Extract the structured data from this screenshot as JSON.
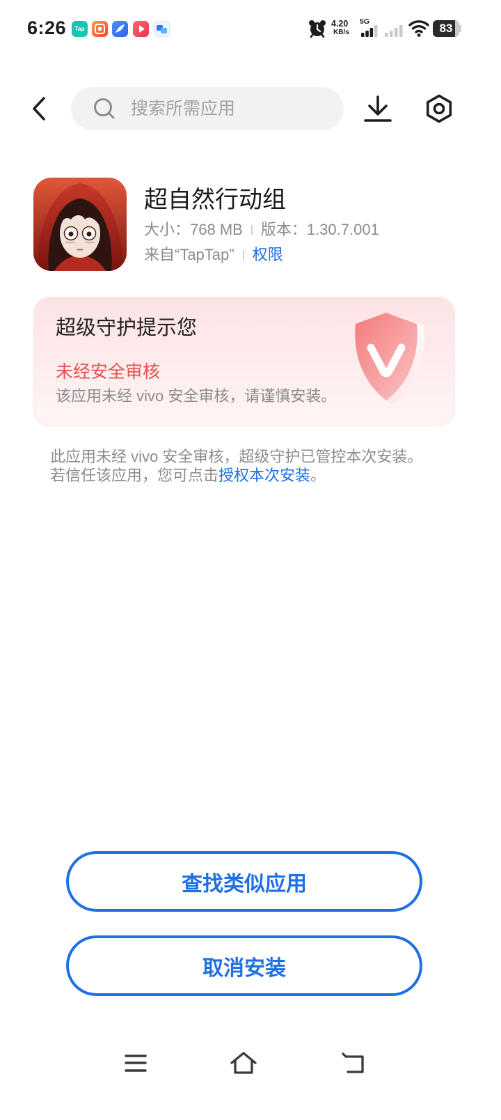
{
  "theme": {
    "accent": "#1f6fe5",
    "danger": "#e5504f"
  },
  "status_bar": {
    "time": "6:26",
    "notification_icons": [
      {
        "icon": "taptap-app-icon",
        "label": "Tap"
      },
      {
        "icon": "orange-app-icon"
      },
      {
        "icon": "blue-browser-app-icon"
      },
      {
        "icon": "red-video-app-icon"
      },
      {
        "icon": "blue-chat-app-icon"
      }
    ],
    "alarm_icon": "alarm-clock-icon",
    "net_speed": "4.20",
    "net_speed_unit": "KB/s",
    "network_type": "5G",
    "sim1_signal_bars": 3,
    "sim2_signal_bars": 0,
    "wifi_icon": "wifi-icon",
    "battery": "83"
  },
  "header": {
    "back_icon": "chevron-left-icon",
    "search_icon": "search-icon",
    "search_placeholder": "搜索所需应用",
    "search_value": "",
    "download_icon": "download-icon",
    "settings_icon": "settings-hexagon-icon"
  },
  "app": {
    "icon": "app-icon",
    "name": "超自然行动组",
    "size": "大小：768 MB",
    "version": "版本：1.30.7.001",
    "source": "来自“TapTap”",
    "permissions_link": "权限"
  },
  "warning_card": {
    "title": "超级守护提示您",
    "status": "未经安全审核",
    "description": "该应用未经 vivo 安全审核，请谨慎安装。",
    "shield_icon": "shield-v-icon"
  },
  "notice": {
    "line1": "此应用未经 vivo 安全审核，超级守护已管控本次安装。",
    "line2_before_link": "若信任该应用，您可点击",
    "line2_link": "授权本次安装",
    "line2_after_link": "。"
  },
  "actions": {
    "find_similar": "查找类似应用",
    "cancel_install": "取消安装"
  },
  "nav_bar": {
    "menu_icon": "menu-lines-icon",
    "home_icon": "home-icon",
    "back_icon": "return-icon"
  }
}
